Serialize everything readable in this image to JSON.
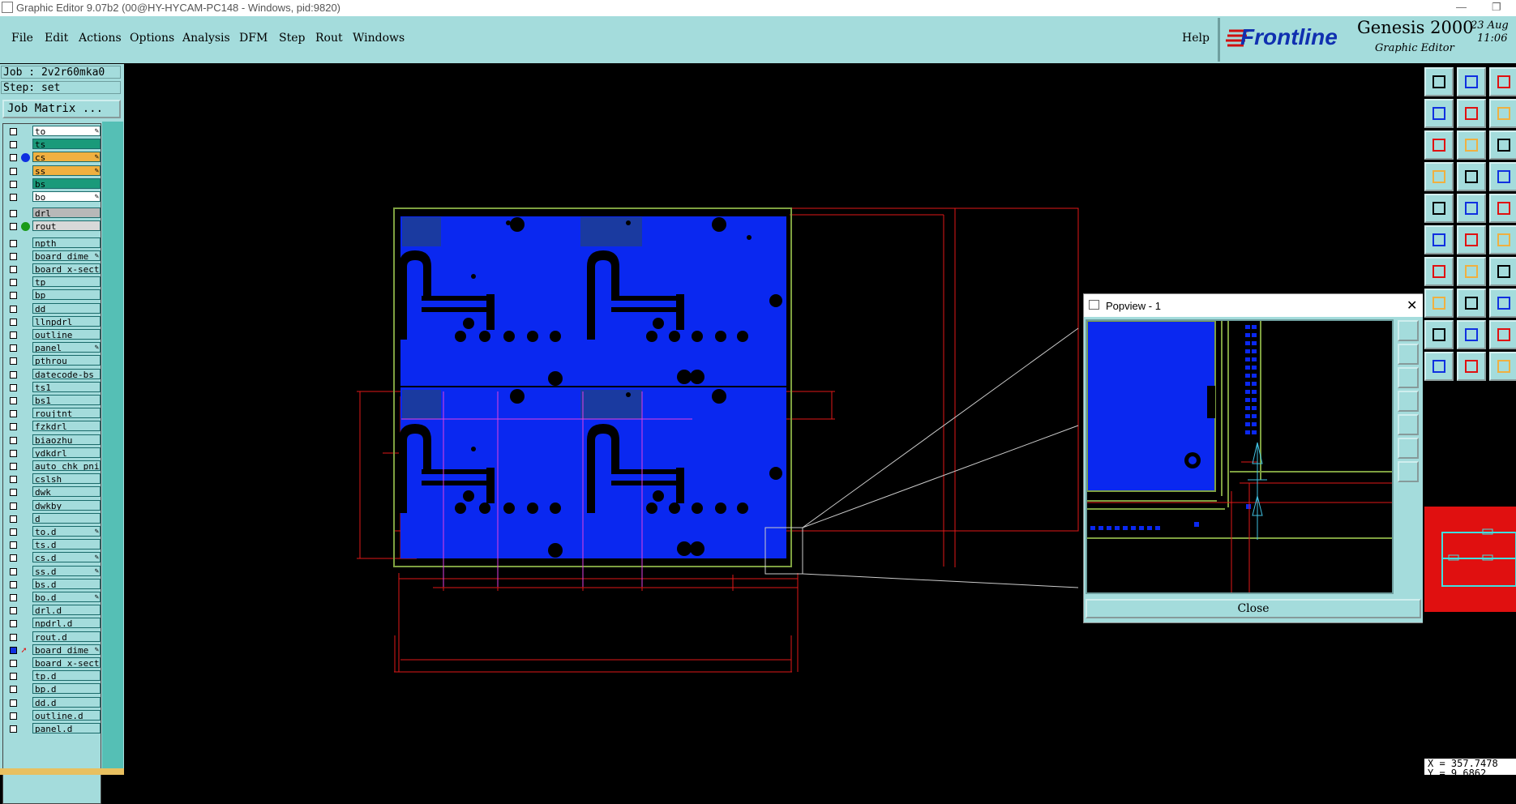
{
  "window": {
    "title": "Graphic Editor 9.07b2 (00@HY-HYCAM-PC148 - Windows, pid:9820)"
  },
  "menu": {
    "items": [
      {
        "label": "File"
      },
      {
        "label": "Edit"
      },
      {
        "label": "Actions"
      },
      {
        "label": "Options"
      },
      {
        "label": "Analysis"
      },
      {
        "label": "DFM"
      },
      {
        "label": "Step"
      },
      {
        "label": "Rout"
      },
      {
        "label": "Windows"
      }
    ],
    "help": "Help"
  },
  "brand": {
    "logo": "Frontline",
    "product": "Genesis 2000",
    "subtitle": "Graphic Editor",
    "date": "23 Aug",
    "time": "11:06"
  },
  "sidebar": {
    "job": "Job : 2v2r60mka0",
    "step": "Step: set",
    "job_matrix": "Job Matrix ..."
  },
  "layers": [
    {
      "name": "to",
      "color": "#ffffff",
      "mark": "✎"
    },
    {
      "name": "ts",
      "color": "#1a9a7a",
      "mark": ""
    },
    {
      "name": "cs",
      "color": "#f0b040",
      "mark": "✎",
      "dot": "#1030e0"
    },
    {
      "name": "ss",
      "color": "#f0b040",
      "mark": "✎"
    },
    {
      "name": "bs",
      "color": "#1a9a7a",
      "mark": ""
    },
    {
      "name": "bo",
      "color": "#ffffff",
      "mark": "✎"
    },
    {
      "name": "drl",
      "color": "#b8b8b8",
      "mark": "",
      "gap": true
    },
    {
      "name": "rout",
      "color": "#d8d8d8",
      "mark": "",
      "dot": "#1a9a1a"
    },
    {
      "name": "npth",
      "color": "#a4dcdc",
      "mark": "",
      "gap": true
    },
    {
      "name": "board_dime",
      "color": "#a4dcdc",
      "mark": "✎"
    },
    {
      "name": "board_x-sect",
      "color": "#a4dcdc",
      "mark": ""
    },
    {
      "name": "tp",
      "color": "#a4dcdc",
      "mark": ""
    },
    {
      "name": "bp",
      "color": "#a4dcdc",
      "mark": ""
    },
    {
      "name": "dd",
      "color": "#a4dcdc",
      "mark": ""
    },
    {
      "name": "llnpdrl",
      "color": "#a4dcdc",
      "mark": ""
    },
    {
      "name": "outline",
      "color": "#a4dcdc",
      "mark": ""
    },
    {
      "name": "panel",
      "color": "#a4dcdc",
      "mark": "✎"
    },
    {
      "name": "pthrou",
      "color": "#a4dcdc",
      "mark": ""
    },
    {
      "name": "datecode-bs",
      "color": "#a4dcdc",
      "mark": ""
    },
    {
      "name": "ts1",
      "color": "#a4dcdc",
      "mark": ""
    },
    {
      "name": "bs1",
      "color": "#a4dcdc",
      "mark": ""
    },
    {
      "name": "roujtnt",
      "color": "#a4dcdc",
      "mark": ""
    },
    {
      "name": "fzkdrl",
      "color": "#a4dcdc",
      "mark": ""
    },
    {
      "name": "biaozhu",
      "color": "#a4dcdc",
      "mark": ""
    },
    {
      "name": "ydkdrl",
      "color": "#a4dcdc",
      "mark": ""
    },
    {
      "name": "auto_chk_pni",
      "color": "#a4dcdc",
      "mark": ""
    },
    {
      "name": "cslsh",
      "color": "#a4dcdc",
      "mark": ""
    },
    {
      "name": "dwk",
      "color": "#a4dcdc",
      "mark": ""
    },
    {
      "name": "dwkby",
      "color": "#a4dcdc",
      "mark": ""
    },
    {
      "name": "d",
      "color": "#a4dcdc",
      "mark": ""
    },
    {
      "name": "to.d",
      "color": "#a4dcdc",
      "mark": "✎"
    },
    {
      "name": "ts.d",
      "color": "#a4dcdc",
      "mark": ""
    },
    {
      "name": "cs.d",
      "color": "#a4dcdc",
      "mark": "✎"
    },
    {
      "name": "ss.d",
      "color": "#a4dcdc",
      "mark": "✎"
    },
    {
      "name": "bs.d",
      "color": "#a4dcdc",
      "mark": ""
    },
    {
      "name": "bo.d",
      "color": "#a4dcdc",
      "mark": "✎"
    },
    {
      "name": "drl.d",
      "color": "#a4dcdc",
      "mark": ""
    },
    {
      "name": "npdrl.d",
      "color": "#a4dcdc",
      "mark": ""
    },
    {
      "name": "rout.d",
      "color": "#a4dcdc",
      "mark": ""
    },
    {
      "name": "board_dime",
      "color": "#a4dcdc",
      "mark": "✎",
      "active": true
    },
    {
      "name": "board_x-sect",
      "color": "#a4dcdc",
      "mark": ""
    },
    {
      "name": "tp.d",
      "color": "#a4dcdc",
      "mark": ""
    },
    {
      "name": "bp.d",
      "color": "#a4dcdc",
      "mark": ""
    },
    {
      "name": "dd.d",
      "color": "#a4dcdc",
      "mark": ""
    },
    {
      "name": "outline.d",
      "color": "#a4dcdc",
      "mark": ""
    },
    {
      "name": "panel.d",
      "color": "#a4dcdc",
      "mark": ""
    }
  ],
  "popview": {
    "title": "Popview - 1",
    "close_label": "Close"
  },
  "coords": {
    "x": "X = 357.7478",
    "y": "Y = 9.6862"
  },
  "colors": {
    "panel_bg": "#a4dcdc",
    "board_fill": "#0a28f0",
    "dimension": "#e01818",
    "outline": "#7ea040"
  }
}
